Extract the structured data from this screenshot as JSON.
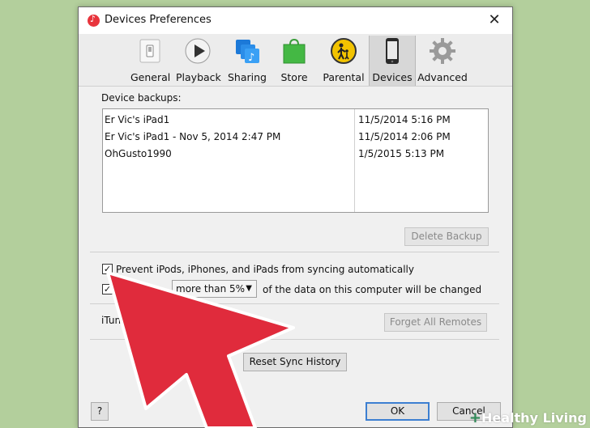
{
  "window": {
    "title": "Devices Preferences",
    "close": "✕"
  },
  "toolbar": {
    "tabs": [
      {
        "label": "General",
        "icon": "general-switch-icon"
      },
      {
        "label": "Playback",
        "icon": "play-icon"
      },
      {
        "label": "Sharing",
        "icon": "sharing-music-icon"
      },
      {
        "label": "Store",
        "icon": "store-bag-icon"
      },
      {
        "label": "Parental",
        "icon": "parental-icon"
      },
      {
        "label": "Devices",
        "icon": "phone-icon"
      },
      {
        "label": "Advanced",
        "icon": "gear-icon"
      }
    ],
    "selected": "Devices"
  },
  "backups": {
    "label": "Device backups:",
    "rows": [
      {
        "name": "Er Vic's iPad1",
        "date": "11/5/2014 5:16 PM"
      },
      {
        "name": "Er Vic's iPad1 - Nov 5, 2014 2:47 PM",
        "date": "11/5/2014 2:06 PM"
      },
      {
        "name": "OhGusto1990",
        "date": "1/5/2015 5:13 PM"
      }
    ],
    "delete_button": "Delete Backup"
  },
  "options": {
    "prevent_sync_label": "Prevent iPods, iPhones, and iPads from syncing automatically",
    "prevent_sync_checked": true,
    "warn_prefix": "W",
    "warn_checked": true,
    "warn_select_value": "more than 5%",
    "warn_suffix": "of the data on this computer will be changed"
  },
  "remotes": {
    "label": "iTunes",
    "label_tail": "tes",
    "forget_button": "Forget All Remotes"
  },
  "reset_button": "Reset Sync History",
  "footer": {
    "help": "?",
    "ok": "OK",
    "cancel": "Cancel"
  },
  "watermark": {
    "plus": "+",
    "text": "Healthy Living"
  },
  "colors": {
    "background": "#b3cf9c",
    "arrow": "#e02b3c",
    "accent": "#3c7fd1"
  }
}
